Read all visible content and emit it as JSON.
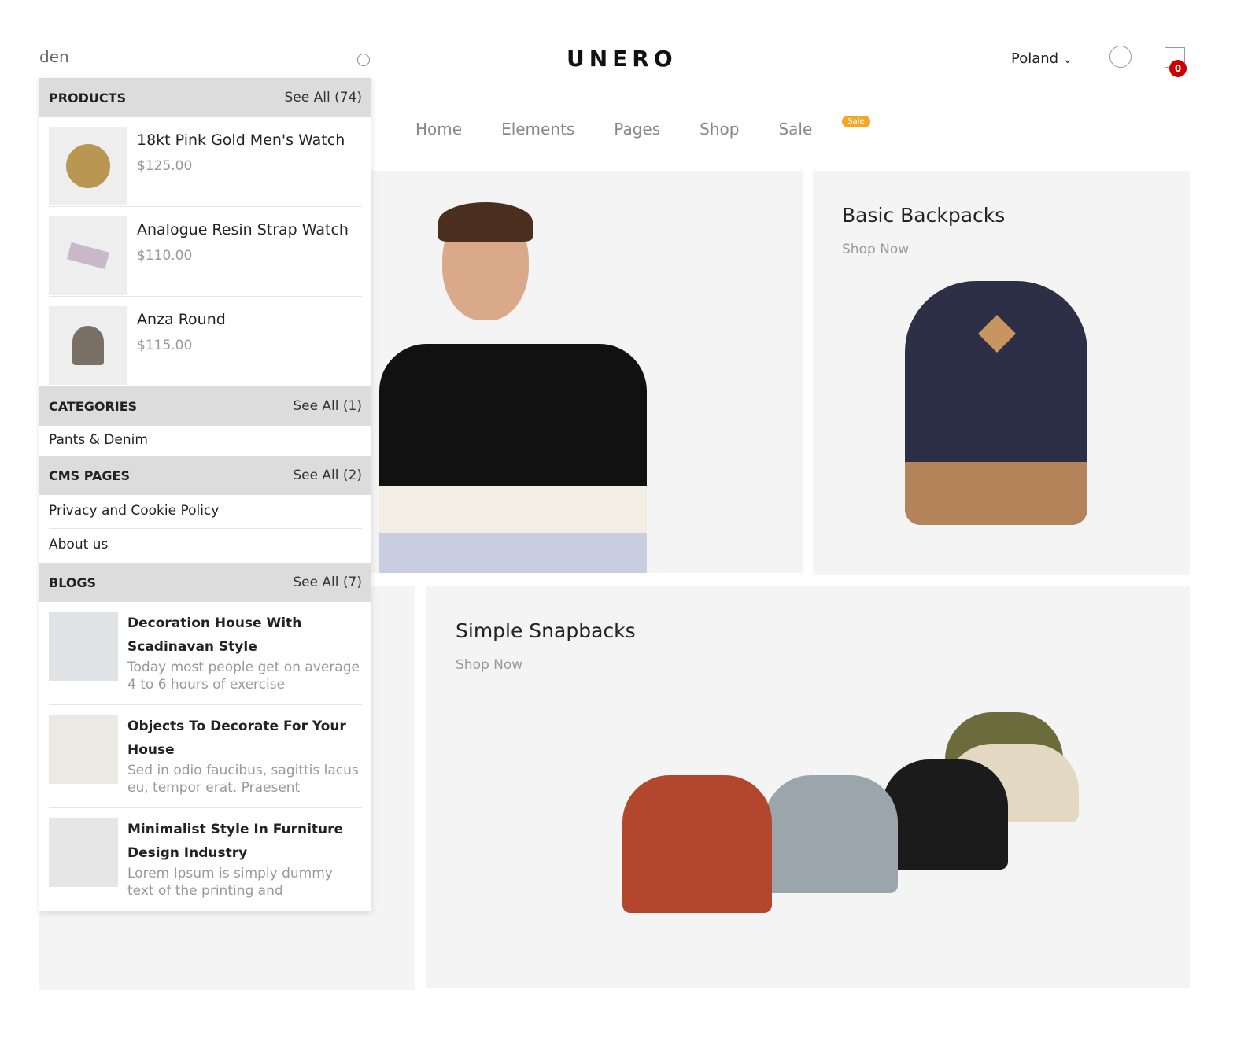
{
  "header": {
    "logo": "UNERO",
    "country": "Poland",
    "cart_count": "0"
  },
  "nav": {
    "items": [
      "Home",
      "Elements",
      "Pages",
      "Shop",
      "Sale"
    ],
    "sale_badge": "Sale"
  },
  "search": {
    "value": "den"
  },
  "results": {
    "products": {
      "title": "PRODUCTS",
      "see_all": "See All (74)",
      "items": [
        {
          "name": "18kt Pink Gold Men's Watch",
          "price": "$125.00"
        },
        {
          "name": "Analogue Resin Strap Watch",
          "price": "$110.00"
        },
        {
          "name": "Anza Round",
          "price": "$115.00"
        }
      ]
    },
    "categories": {
      "title": "CATEGORIES",
      "see_all": "See All (1)",
      "items": [
        "Pants & Denim"
      ]
    },
    "cms": {
      "title": "CMS PAGES",
      "see_all": "See All (2)",
      "items": [
        "Privacy and Cookie Policy",
        "About us"
      ]
    },
    "blogs": {
      "title": "BLOGS",
      "see_all": "See All (7)",
      "items": [
        {
          "title": "Decoration House With Scadinavan Style",
          "excerpt": "Today most people get on average 4 to 6 hours of exercise"
        },
        {
          "title": "Objects To Decorate For Your House",
          "excerpt": "Sed in odio faucibus, sagittis lacus eu, tempor erat. Praesent"
        },
        {
          "title": "Minimalist Style In Furniture Design Industry",
          "excerpt": "Lorem Ipsum is simply dummy text of the printing and"
        }
      ]
    }
  },
  "banners": [
    {
      "title": "Basic Backpacks",
      "cta": "Shop Now"
    },
    {
      "title": "Simple Snapbacks",
      "cta": "Shop Now"
    }
  ],
  "colors": {
    "accent": "#f5a623",
    "cart_badge": "#cc0000",
    "section_bg": "#dcdcdc",
    "tile_bg": "#f4f4f4"
  }
}
